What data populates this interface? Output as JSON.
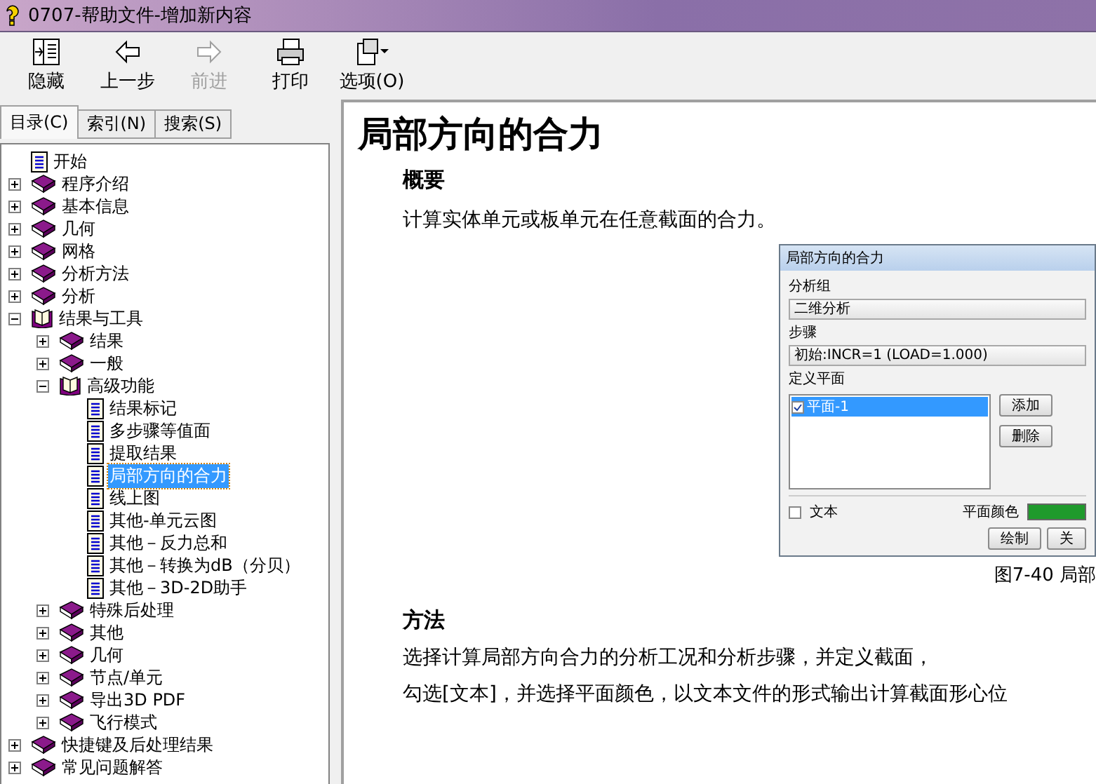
{
  "window": {
    "title": "0707-帮助文件-增加新内容"
  },
  "toolbar": [
    {
      "kind": "hide",
      "label": "隐藏",
      "disabled": false
    },
    {
      "kind": "back",
      "label": "上一步",
      "disabled": false
    },
    {
      "kind": "forward",
      "label": "前进",
      "disabled": true
    },
    {
      "kind": "print",
      "label": "打印",
      "disabled": false
    },
    {
      "kind": "options",
      "label": "选项(O)",
      "disabled": false
    }
  ],
  "tabs": [
    {
      "label": "目录(C)",
      "selected": true
    },
    {
      "label": "索引(N)",
      "selected": false
    },
    {
      "label": "搜索(S)",
      "selected": false
    }
  ],
  "tree": [
    {
      "label": "开始",
      "kind": "page",
      "selected": false
    },
    {
      "label": "程序介绍",
      "kind": "book",
      "expanded": false,
      "selected": false
    },
    {
      "label": "基本信息",
      "kind": "book",
      "expanded": false,
      "selected": false
    },
    {
      "label": "几何",
      "kind": "book",
      "expanded": false,
      "selected": false
    },
    {
      "label": "网格",
      "kind": "book",
      "expanded": false,
      "selected": false
    },
    {
      "label": "分析方法",
      "kind": "book",
      "expanded": false,
      "selected": false
    },
    {
      "label": "分析",
      "kind": "book",
      "expanded": false,
      "selected": false
    },
    {
      "label": "结果与工具",
      "kind": "book",
      "expanded": true,
      "selected": false,
      "children": [
        {
          "label": "结果",
          "kind": "book",
          "expanded": false,
          "selected": false
        },
        {
          "label": "一般",
          "kind": "book",
          "expanded": false,
          "selected": false
        },
        {
          "label": "高级功能",
          "kind": "book",
          "expanded": true,
          "selected": false,
          "children": [
            {
              "label": "结果标记",
              "kind": "page",
              "selected": false
            },
            {
              "label": "多步骤等值面",
              "kind": "page",
              "selected": false
            },
            {
              "label": "提取结果",
              "kind": "page",
              "selected": false
            },
            {
              "label": "局部方向的合力",
              "kind": "page",
              "selected": true
            },
            {
              "label": "线上图",
              "kind": "page",
              "selected": false
            },
            {
              "label": "其他-单元云图",
              "kind": "page",
              "selected": false
            },
            {
              "label": "其他－反力总和",
              "kind": "page",
              "selected": false
            },
            {
              "label": "其他－转换为dB（分贝）",
              "kind": "page",
              "selected": false
            },
            {
              "label": "其他－3D-2D助手",
              "kind": "page",
              "selected": false
            }
          ]
        },
        {
          "label": "特殊后处理",
          "kind": "book",
          "expanded": false,
          "selected": false
        },
        {
          "label": "其他",
          "kind": "book",
          "expanded": false,
          "selected": false
        },
        {
          "label": "几何",
          "kind": "book",
          "expanded": false,
          "selected": false
        },
        {
          "label": "节点/单元",
          "kind": "book",
          "expanded": false,
          "selected": false
        },
        {
          "label": "导出3D PDF",
          "kind": "book",
          "expanded": false,
          "selected": false
        },
        {
          "label": "飞行模式",
          "kind": "book",
          "expanded": false,
          "selected": false
        }
      ]
    },
    {
      "label": "快捷键及后处理结果",
      "kind": "book",
      "expanded": false,
      "selected": false
    },
    {
      "label": "常见问题解答",
      "kind": "book",
      "expanded": false,
      "selected": false
    }
  ],
  "article": {
    "title": "局部方向的合力",
    "overview_heading": "概要",
    "overview_text": "计算实体单元或板单元在任意截面的合力。",
    "figure": {
      "dialog_title": "局部方向的合力",
      "group_label": "分析组",
      "group_value": "二维分析",
      "step_label": "步骤",
      "step_value": "初始:INCR=1 (LOAD=1.000)",
      "plane_section": "定义平面",
      "planes": [
        {
          "label": "平面-1",
          "checked": true,
          "selected": true
        }
      ],
      "side_buttons": [
        "添加",
        "删除"
      ],
      "text_checkbox": {
        "label": "文本",
        "checked": false
      },
      "color_label": "平面颜色",
      "bottom_buttons": [
        "绘制",
        "关"
      ]
    },
    "caption": "图7-40 局部",
    "method_heading": "方法",
    "method_lines": [
      "选择计算局部方向合力的分析工况和分析步骤，并定义截面，",
      "勾选[文本]，并选择平面颜色，以文本文件的形式输出计算截面形心位"
    ]
  }
}
